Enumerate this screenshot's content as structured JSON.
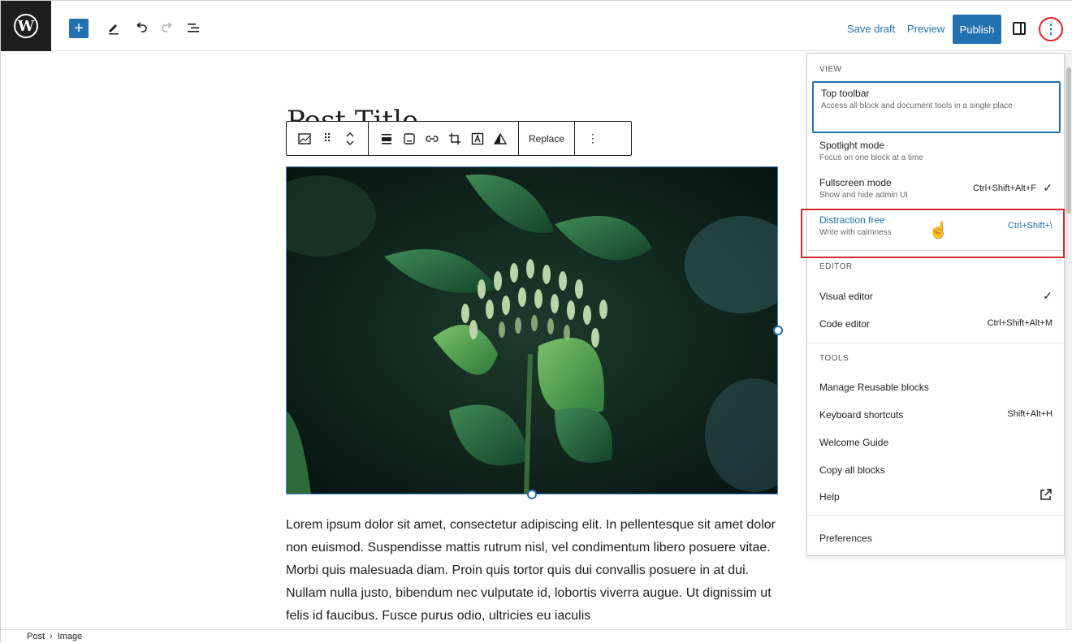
{
  "toolbar": {
    "save_draft": "Save draft",
    "preview": "Preview",
    "publish": "Publish"
  },
  "editor": {
    "post_title": "Post Title",
    "block_toolbar": {
      "replace": "Replace"
    },
    "paragraph": "Lorem ipsum dolor sit amet, consectetur adipiscing elit. In pellentesque sit amet dolor non euismod. Suspendisse mattis rutrum nisl, vel condimentum libero posuere vitae. Morbi quis malesuada diam. Proin quis tortor quis dui convallis posuere in at dui. Nullam nulla justo, bibendum nec vulputate id, lobortis viverra augue. Ut dignissim ut felis id faucibus. Fusce purus odio, ultricies eu iaculis"
  },
  "footer": {
    "breadcrumb": [
      "Post",
      "Image"
    ]
  },
  "menu": {
    "view_title": "VIEW",
    "editor_title": "EDITOR",
    "tools_title": "TOOLS",
    "top_toolbar": {
      "label": "Top toolbar",
      "desc": "Access all block and document tools in a single place"
    },
    "spotlight": {
      "label": "Spotlight mode",
      "desc": "Focus on one block at a time"
    },
    "fullscreen": {
      "label": "Fullscreen mode",
      "desc": "Show and hide admin UI",
      "shortcut": "Ctrl+Shift+Alt+F"
    },
    "distraction": {
      "label": "Distraction free",
      "desc": "Write with calmness",
      "shortcut": "Ctrl+Shift+\\"
    },
    "visual_editor": {
      "label": "Visual editor"
    },
    "code_editor": {
      "label": "Code editor",
      "shortcut": "Ctrl+Shift+Alt+M"
    },
    "manage_reusable": {
      "label": "Manage Reusable blocks"
    },
    "keyboard_shortcuts": {
      "label": "Keyboard shortcuts",
      "shortcut": "Shift+Alt+H"
    },
    "welcome_guide": {
      "label": "Welcome Guide"
    },
    "copy_all": {
      "label": "Copy all blocks"
    },
    "help": {
      "label": "Help"
    },
    "preferences": {
      "label": "Preferences"
    }
  },
  "icons": {
    "logo": "wordpress-icon",
    "add": "plus-icon",
    "edit": "pencil-icon",
    "undo": "undo-icon",
    "redo": "redo-icon",
    "list_view": "list-view-icon",
    "settings": "sidebar-toggle-icon",
    "more": "vertical-ellipsis-icon"
  },
  "colors": {
    "accent": "#2271b1",
    "annotation_red": "#d42a2a"
  }
}
